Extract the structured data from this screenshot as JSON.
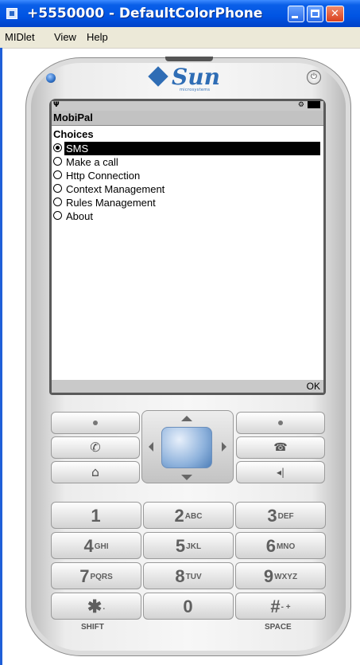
{
  "window": {
    "title": "+5550000 - DefaultColorPhone",
    "menu": [
      "MIDlet",
      "View",
      "Help"
    ]
  },
  "phone": {
    "brand": "Sun",
    "brand_sub": "microsystems",
    "screen": {
      "app_title": "MobiPal",
      "list_title": "Choices",
      "choices": [
        {
          "label": "SMS",
          "selected": true
        },
        {
          "label": "Make a call",
          "selected": false
        },
        {
          "label": "Http Connection",
          "selected": false
        },
        {
          "label": "Context Management",
          "selected": false
        },
        {
          "label": "Rules Management",
          "selected": false
        },
        {
          "label": "About",
          "selected": false
        }
      ],
      "softkey_right": "OK"
    },
    "keypad": [
      {
        "num": "1",
        "letters": ""
      },
      {
        "num": "2",
        "letters": "ABC"
      },
      {
        "num": "3",
        "letters": "DEF"
      },
      {
        "num": "4",
        "letters": "GHI"
      },
      {
        "num": "5",
        "letters": "JKL"
      },
      {
        "num": "6",
        "letters": "MNO"
      },
      {
        "num": "7",
        "letters": "PQRS"
      },
      {
        "num": "8",
        "letters": "TUV"
      },
      {
        "num": "9",
        "letters": "WXYZ"
      },
      {
        "num": "✱",
        "letters": "."
      },
      {
        "num": "0",
        "letters": ""
      },
      {
        "num": "#",
        "letters": "- +"
      }
    ],
    "shift_label": "SHIFT",
    "space_label": "SPACE"
  },
  "colors": {
    "titlebar": "#0054e3",
    "dpad": "#8eb2dc",
    "selection": "#000000"
  }
}
